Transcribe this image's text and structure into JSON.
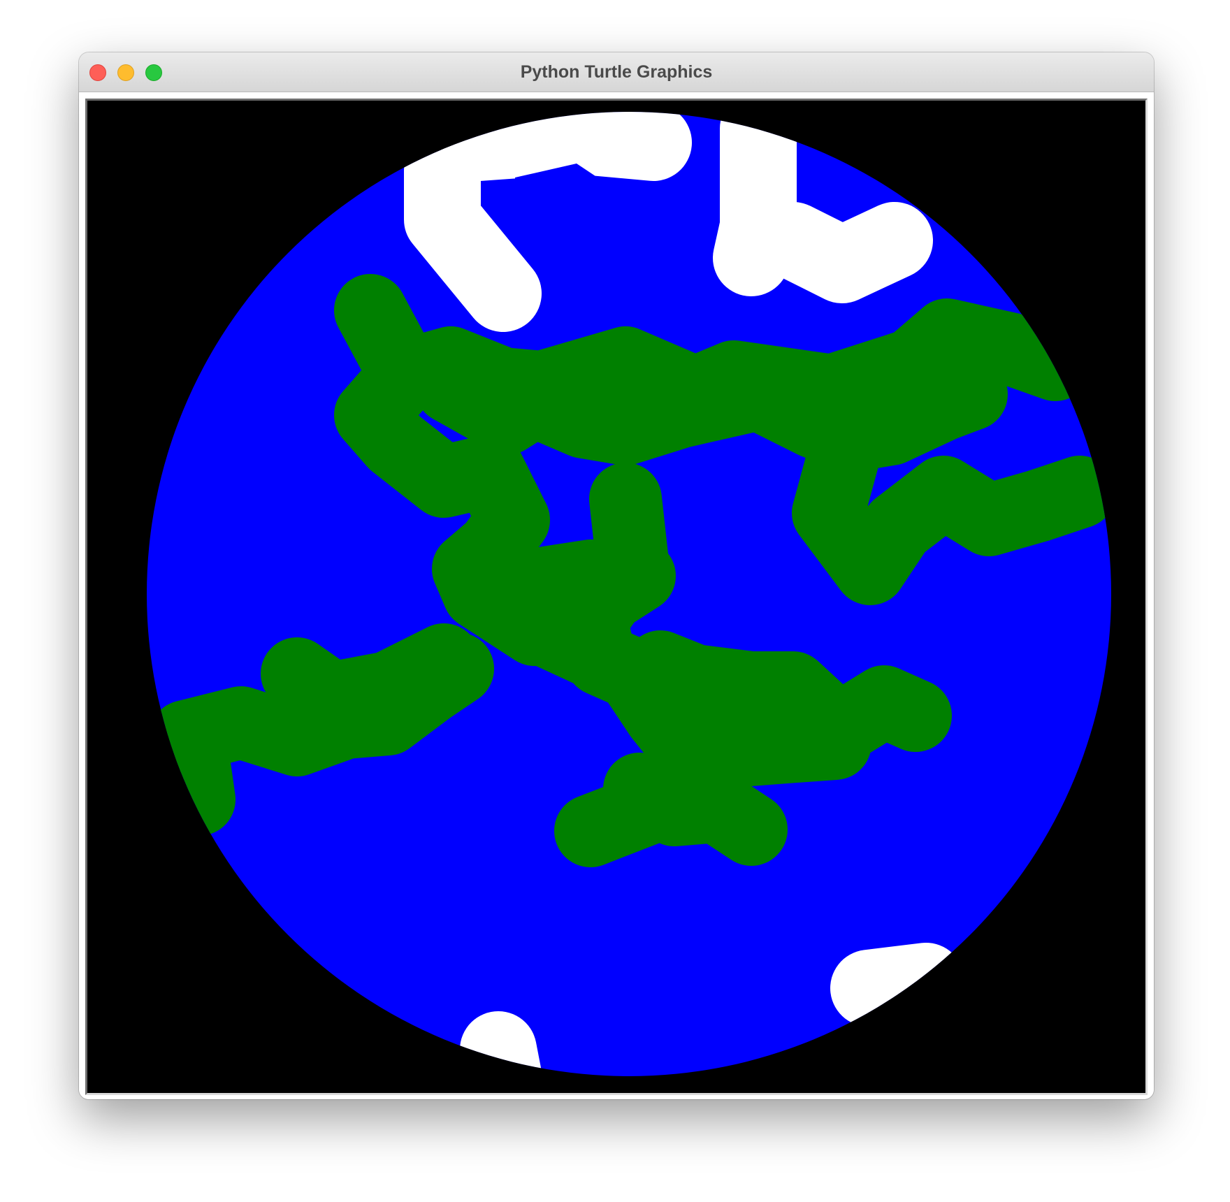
{
  "window": {
    "title": "Python Turtle Graphics"
  },
  "controls": {
    "close": "close-button",
    "minimize": "minimize-button",
    "zoom": "zoom-button"
  },
  "colors": {
    "background": "#000000",
    "ocean": "#0000ff",
    "land": "#008000",
    "ice": "#ffffff"
  }
}
